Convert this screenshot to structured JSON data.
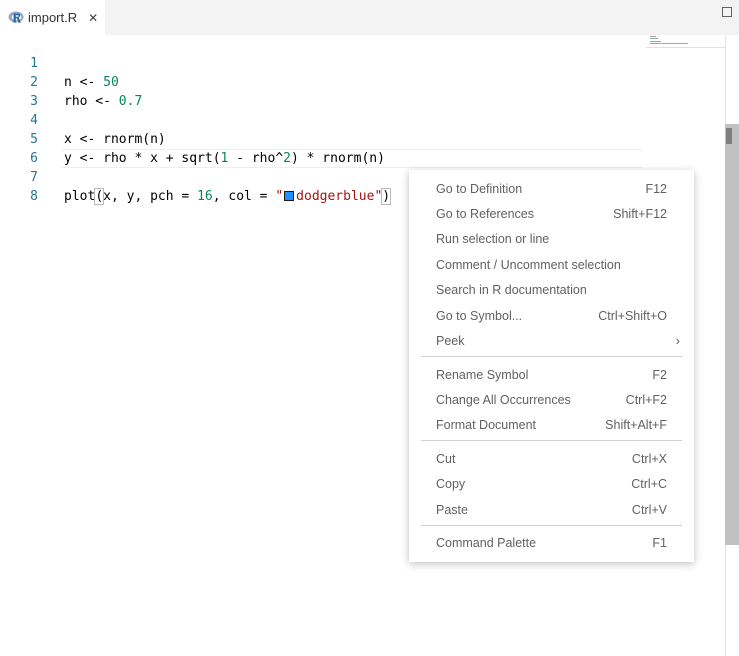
{
  "tab": {
    "label": "import.R",
    "close": "✕",
    "icon": "r-language-icon"
  },
  "editor": {
    "lines": [
      {
        "n": "1"
      },
      {
        "n": "2"
      },
      {
        "n": "3"
      },
      {
        "n": "4"
      },
      {
        "n": "5"
      },
      {
        "n": "6"
      },
      {
        "n": "7"
      },
      {
        "n": "8"
      }
    ],
    "code": {
      "l1_a": "n <- ",
      "l1_num": "50",
      "l2_a": "rho <- ",
      "l2_num": "0.7",
      "l4": "x <- rnorm(n)",
      "l5_a": "y <- rho * x + sqrt(",
      "l5_num1": "1",
      "l5_b": " - rho^",
      "l5_num2": "2",
      "l5_c": ") * rnorm(n)",
      "l7_a": "plot",
      "l7_paren": "(",
      "l7_b": "x, y, pch = ",
      "l7_num": "16",
      "l7_c": ", col = ",
      "l7_q1": "\"",
      "l7_str": "dodgerblue",
      "l7_q2": "\"",
      "l7_paren2": ")"
    },
    "colors": {
      "swatch": "#1e90ff"
    }
  },
  "context_menu": {
    "groups": [
      [
        {
          "label": "Go to Definition",
          "key": "F12"
        },
        {
          "label": "Go to References",
          "key": "Shift+F12"
        },
        {
          "label": "Run selection or line",
          "key": ""
        },
        {
          "label": "Comment / Uncomment selection",
          "key": ""
        },
        {
          "label": "Search in R documentation",
          "key": ""
        },
        {
          "label": "Go to Symbol...",
          "key": "Ctrl+Shift+O"
        },
        {
          "label": "Peek",
          "key": "",
          "submenu": "›"
        }
      ],
      [
        {
          "label": "Rename Symbol",
          "key": "F2"
        },
        {
          "label": "Change All Occurrences",
          "key": "Ctrl+F2"
        },
        {
          "label": "Format Document",
          "key": "Shift+Alt+F"
        }
      ],
      [
        {
          "label": "Cut",
          "key": "Ctrl+X"
        },
        {
          "label": "Copy",
          "key": "Ctrl+C"
        },
        {
          "label": "Paste",
          "key": "Ctrl+V"
        }
      ],
      [
        {
          "label": "Command Palette",
          "key": "F1"
        }
      ]
    ]
  }
}
